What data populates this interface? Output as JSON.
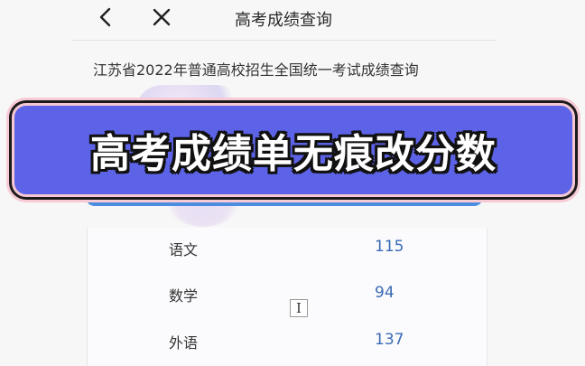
{
  "nav": {
    "back_icon": "chevron-left-icon",
    "close_icon": "close-icon",
    "title": "高考成绩查询"
  },
  "subtitle": "江苏省2022年普通高校招生全国统一考试成绩查询",
  "banner": {
    "text": "高考成绩单无痕改分数",
    "bg_color": "#5d63e6",
    "border_color": "#f4c7d2"
  },
  "scores": [
    {
      "subject": "语文",
      "score": "115"
    },
    {
      "subject": "数学",
      "score": "94"
    },
    {
      "subject": "外语",
      "score": "137"
    }
  ],
  "colors": {
    "score_text": "#3b6bb5",
    "accent_strip": "#4c8de0"
  },
  "cursor_icon": "text-cursor-icon"
}
